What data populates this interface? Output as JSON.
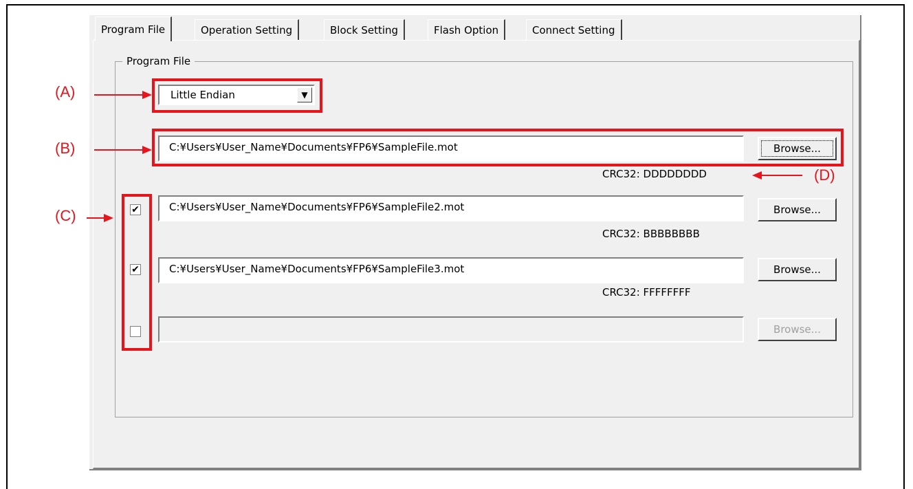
{
  "tabs": [
    {
      "label": "Program File",
      "active": true
    },
    {
      "label": "Operation Setting",
      "active": false
    },
    {
      "label": "Block Setting",
      "active": false
    },
    {
      "label": "Flash Option",
      "active": false
    },
    {
      "label": "Connect Setting",
      "active": false
    }
  ],
  "group_title": "Program File",
  "endian_select": {
    "selected": "Little Endian"
  },
  "files": [
    {
      "checked": null,
      "path": "C:¥Users¥User_Name¥Documents¥FP6¥SampleFile.mot",
      "browse_label": "Browse...",
      "crc": "CRC32: DDDDDDDD",
      "enabled": true
    },
    {
      "checked": true,
      "path": "C:¥Users¥User_Name¥Documents¥FP6¥SampleFile2.mot",
      "browse_label": "Browse...",
      "crc": "CRC32: BBBBBBBB",
      "enabled": true
    },
    {
      "checked": true,
      "path": "C:¥Users¥User_Name¥Documents¥FP6¥SampleFile3.mot",
      "browse_label": "Browse...",
      "crc": "CRC32: FFFFFFFF",
      "enabled": true
    },
    {
      "checked": false,
      "path": "",
      "browse_label": "Browse...",
      "crc": "",
      "enabled": false
    }
  ],
  "callouts": {
    "a": "(A)",
    "b": "(B)",
    "c": "(C)",
    "d": "(D)"
  },
  "colors": {
    "highlight": "#e8141c",
    "dialog_bg": "#f0f0f0"
  }
}
